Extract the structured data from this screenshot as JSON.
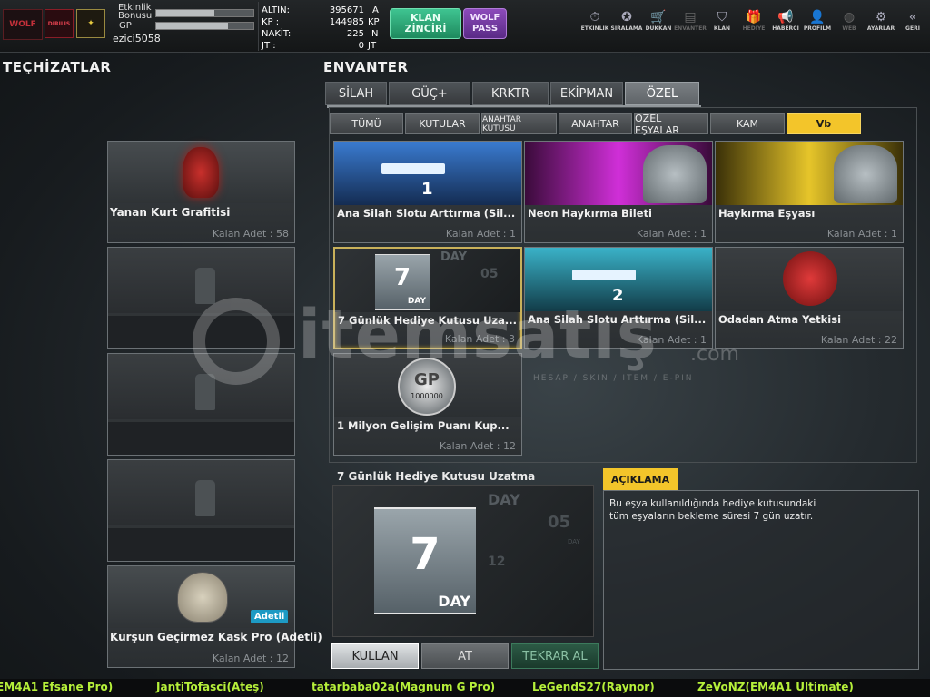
{
  "topbar": {
    "badges": [
      "WOLF",
      "DIRILIS",
      ""
    ],
    "badge_sub": "DIRILIS",
    "event_bonus_label_1": "Etkinlik",
    "event_bonus_label_2": "Bonusu",
    "gp_label": "GP",
    "event_bonus_progress": 0.6,
    "gp_progress": 0.74,
    "username": "ezici5058",
    "currencies": [
      {
        "label": "ALTIN:",
        "value": "395671",
        "unit": "A"
      },
      {
        "label": "KP   :",
        "value": "144985",
        "unit": "KP"
      },
      {
        "label": "NAKİT:",
        "value": "225",
        "unit": "N"
      },
      {
        "label": "JT   :",
        "value": "0",
        "unit": "JT"
      }
    ],
    "klan_button": "KLAN ZİNCİRİ",
    "wolf_pass_1": "WOLF",
    "wolf_pass_2": "PASS",
    "nav": [
      {
        "label": "ETKİNLİK",
        "icon": "⏱",
        "active": true
      },
      {
        "label": "SIRALAMA",
        "icon": "✪",
        "active": true
      },
      {
        "label": "DÜKKAN",
        "icon": "🛒",
        "active": true
      },
      {
        "label": "ENVANTER",
        "icon": "▤",
        "active": false
      },
      {
        "label": "KLAN",
        "icon": "⛉",
        "active": true
      },
      {
        "label": "HEDİYE",
        "icon": "🎁",
        "active": false
      },
      {
        "label": "HABERCİ",
        "icon": "📢",
        "active": true
      },
      {
        "label": "PROFİLM",
        "icon": "👤",
        "active": true
      },
      {
        "label": "WEB",
        "icon": "◍",
        "active": false
      },
      {
        "label": "AYARLAR",
        "icon": "⚙",
        "active": true
      },
      {
        "label": "GERİ",
        "icon": "«",
        "active": true
      }
    ]
  },
  "left": {
    "title": "TEÇHİZATLAR",
    "slots": [
      {
        "name": "Yanan Kurt Grafitisi",
        "qty": "Kalan Adet : 58",
        "empty": false
      },
      {
        "name": "",
        "qty": "",
        "empty": true
      },
      {
        "name": "",
        "qty": "",
        "empty": true
      },
      {
        "name": "",
        "qty": "",
        "empty": true
      },
      {
        "name": "Kurşun Geçirmez Kask Pro (Adetli)",
        "qty": "Kalan Adet : 12",
        "empty": false,
        "tag": "Adetli"
      }
    ]
  },
  "inventory": {
    "title": "ENVANTER",
    "tabs": [
      "SİLAH",
      "GÜÇ+",
      "KRKTR",
      "EKİPMAN",
      "ÖZEL"
    ],
    "active_tab": "ÖZEL",
    "subtabs": [
      "TÜMÜ",
      "KUTULAR",
      "ANAHTAR KUTUSU",
      "ANAHTAR",
      "ÖZEL EŞYALAR",
      "KAM",
      "Vb"
    ],
    "active_subtab": "Vb",
    "items": [
      {
        "name": "Ana Silah Slotu Arttırma (Sil...",
        "qty": "Kalan Adet : 1",
        "thumb_text": "1"
      },
      {
        "name": "Neon Haykırma Bileti",
        "qty": "Kalan Adet : 1",
        "thumb_text": ""
      },
      {
        "name": "Haykırma Eşyası",
        "qty": "Kalan Adet : 1",
        "thumb_text": ""
      },
      {
        "name": "7 Günlük Hediye Kutusu Uza...",
        "qty": "Kalan Adet : 3",
        "thumb_text": "7",
        "thumb_sub": "DAY"
      },
      {
        "name": "Ana Silah Slotu Arttırma (Sil...",
        "qty": "Kalan Adet : 1",
        "thumb_text": "2"
      },
      {
        "name": "Odadan Atma Yetkisi",
        "qty": "Kalan Adet : 22",
        "thumb_text": ""
      },
      {
        "name": "1 Milyon Gelişim Puanı Kup...",
        "qty": "Kalan Adet : 12",
        "thumb_text": "GP",
        "thumb_sub": "1000000"
      }
    ],
    "selected_index": 3
  },
  "detail": {
    "title": "7 Günlük Hediye Kutusu Uzatma",
    "big_number": "7",
    "big_sub": "DAY",
    "bg_text_1": "DAY",
    "bg_text_2": "05",
    "bg_text_3": "DAY",
    "bg_text_4": "12",
    "desc_header": "AÇIKLAMA",
    "desc_text_1": "Bu eşya kullanıldığında hediye kutusundaki",
    "desc_text_2": "tüm eşyaların bekleme süresi 7 gün uzatır.",
    "buttons": {
      "use": "KULLAN",
      "throw": "AT",
      "rebuy": "TEKRAR AL"
    }
  },
  "watermark": {
    "brand": "itemsatış",
    "suffix": ".com",
    "tagline": "HESAP / SKIN / ITEM / E-PIN"
  },
  "ticker": [
    "EM4A1 Efsane Pro)",
    "JantiTofasci(Ateş)",
    "tatarbaba02a(Magnum G Pro)",
    "LeGendS27(Raynor)",
    "ZeVoNZ(EM4A1 Ultimate)"
  ],
  "colors": {
    "accent": "#f3c52a",
    "klan": "#2fa87a",
    "wolfpass": "#7b3fa6",
    "ticker": "#b6f03a"
  }
}
